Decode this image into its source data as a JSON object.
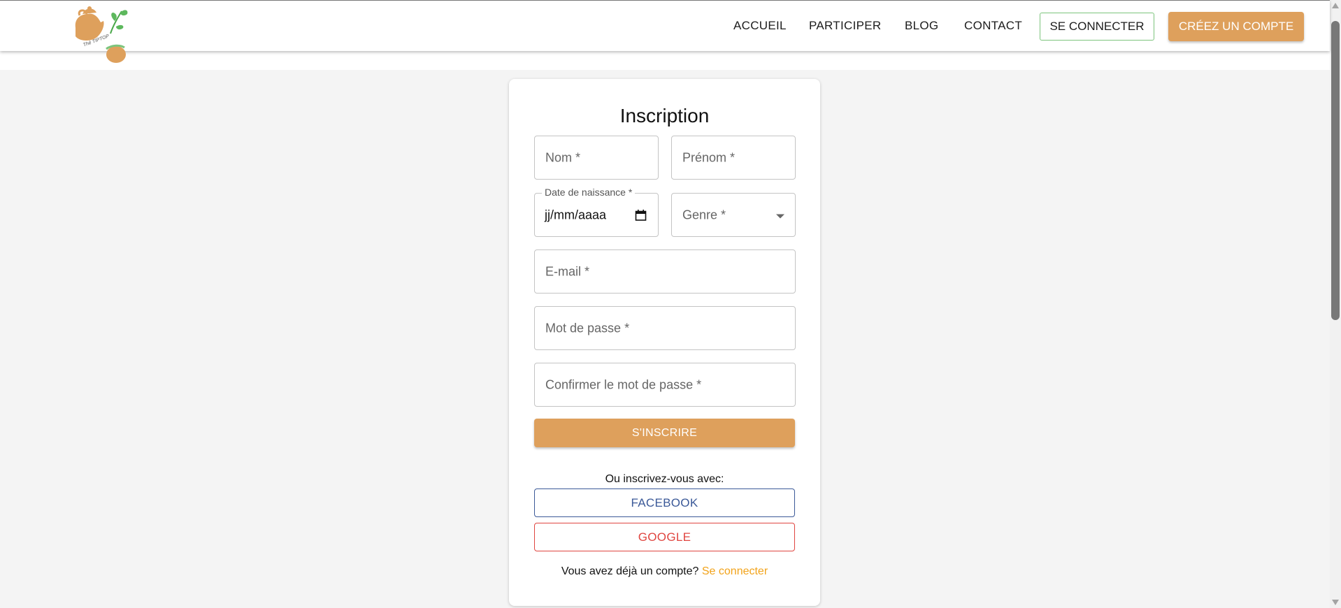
{
  "brand": {
    "logo_text": "Thé TIPTOP"
  },
  "nav": {
    "links": [
      "ACCUEIL",
      "PARTICIPER",
      "BLOG",
      "CONTACT"
    ],
    "login_label": "SE CONNECTER",
    "create_label": "CRÉEZ UN COMPTE"
  },
  "form": {
    "title": "Inscription",
    "fields": {
      "nom": "Nom *",
      "prenom": "Prénom *",
      "birth_legend": "Date de naissance *",
      "birth_value": "jj/mm/aaaa",
      "genre": "Genre *",
      "email": "E-mail *",
      "password": "Mot de passe *",
      "confirm": "Confirmer le mot de passe *"
    },
    "submit_label": "S'INSCRIRE",
    "or_text": "Ou inscrivez-vous avec:",
    "facebook_label": "FACEBOOK",
    "google_label": "GOOGLE",
    "have_account": "Vous avez déjà un compte?",
    "login_link": "Se connecter"
  },
  "colors": {
    "accent": "#dea05c",
    "facebook": "#3b5998",
    "google": "#e04540",
    "link": "#f2a31a",
    "login_border": "#7cc47c"
  }
}
